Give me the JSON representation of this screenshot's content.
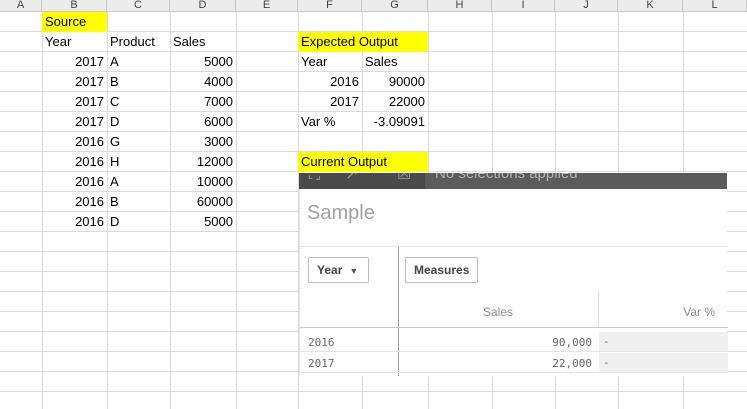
{
  "columns": [
    "A",
    "B",
    "C",
    "D",
    "E",
    "F",
    "G",
    "H",
    "I",
    "J",
    "K",
    "L"
  ],
  "source": {
    "title": "Source",
    "headers": [
      "Year",
      "Product",
      "Sales"
    ],
    "rows": [
      [
        "2017",
        "A",
        "5000"
      ],
      [
        "2017",
        "B",
        "4000"
      ],
      [
        "2017",
        "C",
        "7000"
      ],
      [
        "2017",
        "D",
        "6000"
      ],
      [
        "2016",
        "G",
        "3000"
      ],
      [
        "2016",
        "H",
        "12000"
      ],
      [
        "2016",
        "A",
        "10000"
      ],
      [
        "2016",
        "B",
        "60000"
      ],
      [
        "2016",
        "D",
        "5000"
      ]
    ]
  },
  "expected": {
    "title": "Expected Output",
    "headers": [
      "Year",
      "Sales"
    ],
    "rows": [
      [
        "2016",
        "90000"
      ],
      [
        "2017",
        "22000"
      ]
    ],
    "var_label": "Var %",
    "var_value": "-3.09091"
  },
  "current_title": "Current Output",
  "qlik": {
    "status": "No selections applied",
    "title": "Sample",
    "year_button": "Year",
    "measures_button": "Measures",
    "col_sales": "Sales",
    "col_var": "Var %",
    "rows": [
      {
        "year": "2016",
        "sales": "90,000",
        "var": "-"
      },
      {
        "year": "2017",
        "sales": "22,000",
        "var": "-"
      }
    ],
    "colors": {
      "toolbar": "#5b5b5b",
      "highlight": "#ffff00"
    }
  }
}
